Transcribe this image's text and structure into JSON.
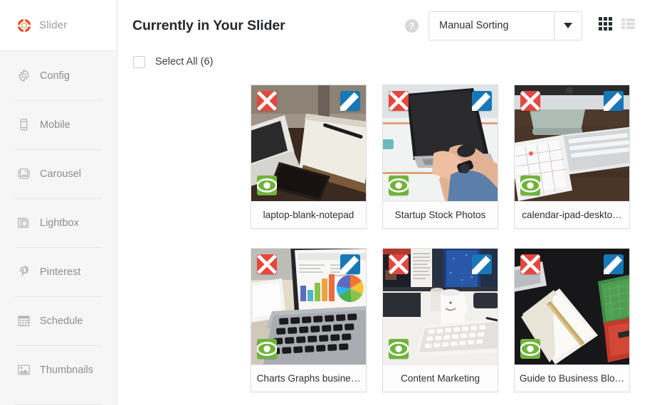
{
  "sidebar": {
    "brand": {
      "label": "Slider",
      "icon": "slider-ring-logo",
      "color": "#e8472b"
    },
    "items": [
      {
        "label": "Config",
        "icon": "gear-icon"
      },
      {
        "label": "Mobile",
        "icon": "mobile-phone-icon"
      },
      {
        "label": "Carousel",
        "icon": "carousel-image-icon"
      },
      {
        "label": "Lightbox",
        "icon": "lightbox-window-icon"
      },
      {
        "label": "Pinterest",
        "icon": "pinterest-icon"
      },
      {
        "label": "Schedule",
        "icon": "calendar-icon"
      },
      {
        "label": "Thumbnails",
        "icon": "thumbnails-image-icon"
      }
    ]
  },
  "header": {
    "title": "Currently in Your Slider",
    "help_icon": "question-mark-icon",
    "help_label": "?",
    "sort_select": {
      "value": "Manual Sorting",
      "arrow_icon": "chevron-down-icon"
    },
    "view_grid": {
      "icon": "grid-view-icon",
      "active": true
    },
    "view_list": {
      "icon": "list-view-icon",
      "active": false
    }
  },
  "select_all": {
    "label": "Select All (6)",
    "checked": false
  },
  "card_buttons": {
    "delete": {
      "icon": "close-x-icon",
      "color": "#e8453c"
    },
    "edit": {
      "icon": "pencil-edit-icon",
      "color": "#1678b8"
    },
    "preview": {
      "icon": "eye-preview-icon",
      "color": "#70b33b"
    }
  },
  "slides": [
    {
      "caption": "laptop-blank-notepad",
      "image": "laptop-notepad-pen-phone-on-wood-desk"
    },
    {
      "caption": "Startup Stock Photos",
      "image": "hands-typing-on-laptop-white-desk"
    },
    {
      "caption": "calendar-ipad-deskto…",
      "image": "imac-keyboard-ipad-calendar-wood-desk"
    },
    {
      "caption": "Charts Graphs busine…",
      "image": "laptop-screen-bar-and-pie-charts"
    },
    {
      "caption": "Content Marketing",
      "image": "monitors-white-mug-keyboard-desk"
    },
    {
      "caption": "Guide to Business Blo…",
      "image": "open-notebook-green-mat-dark-desk"
    }
  ]
}
